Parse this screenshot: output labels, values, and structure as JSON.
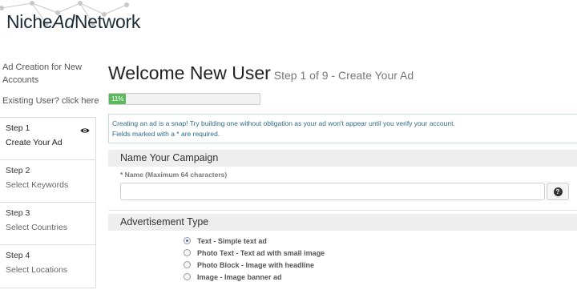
{
  "header": {
    "logo_part1": "Niche",
    "logo_part2": "Ad",
    "logo_part3": "Network"
  },
  "sidebar": {
    "intro": "Ad Creation for New Accounts",
    "existing_user": "Existing User? click here",
    "steps": [
      {
        "num": "Step 1",
        "label": "Create Your Ad",
        "active": true
      },
      {
        "num": "Step 2",
        "label": "Select Keywords"
      },
      {
        "num": "Step 3",
        "label": "Select Countries"
      },
      {
        "num": "Step 4",
        "label": "Select Locations"
      }
    ]
  },
  "main": {
    "title": "Welcome New User",
    "subtitle": "Step 1 of 9 - Create Your Ad",
    "progress_label": "11%",
    "progress_value": 11,
    "info_line1": "Creating an ad is a snap!  Try building one without obligation as your ad won't appear until you verify your account.",
    "info_line2": "Fields marked with a * are required.",
    "campaign_heading": "Name Your Campaign",
    "name_label": "* Name (Maximum 64 characters)",
    "name_value": "",
    "ad_type_heading": "Advertisement Type",
    "ad_types": [
      {
        "label": "Text - Simple text ad",
        "checked": true
      },
      {
        "label": "Photo Text - Text ad with small image",
        "checked": false
      },
      {
        "label": "Photo Block - Image with headline",
        "checked": false
      },
      {
        "label": "Image - Image banner ad",
        "checked": false
      }
    ]
  },
  "colors": {
    "progress": "#5cb85c",
    "info_text": "#2e6b8a"
  }
}
